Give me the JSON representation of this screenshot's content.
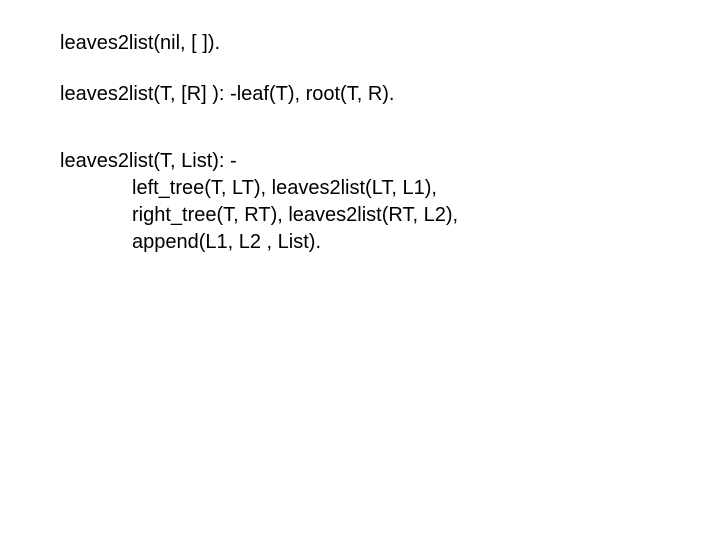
{
  "code": {
    "line1": "leaves2list(nil, [ ]).",
    "line2": "leaves2list(T, [R] ): -leaf(T), root(T, R).",
    "line3": "leaves2list(T, List): -",
    "line4": "left_tree(T, LT), leaves2list(LT, L1),",
    "line5": "right_tree(T, RT), leaves2list(RT, L2),",
    "line6": "append(L1, L2 , List)."
  }
}
